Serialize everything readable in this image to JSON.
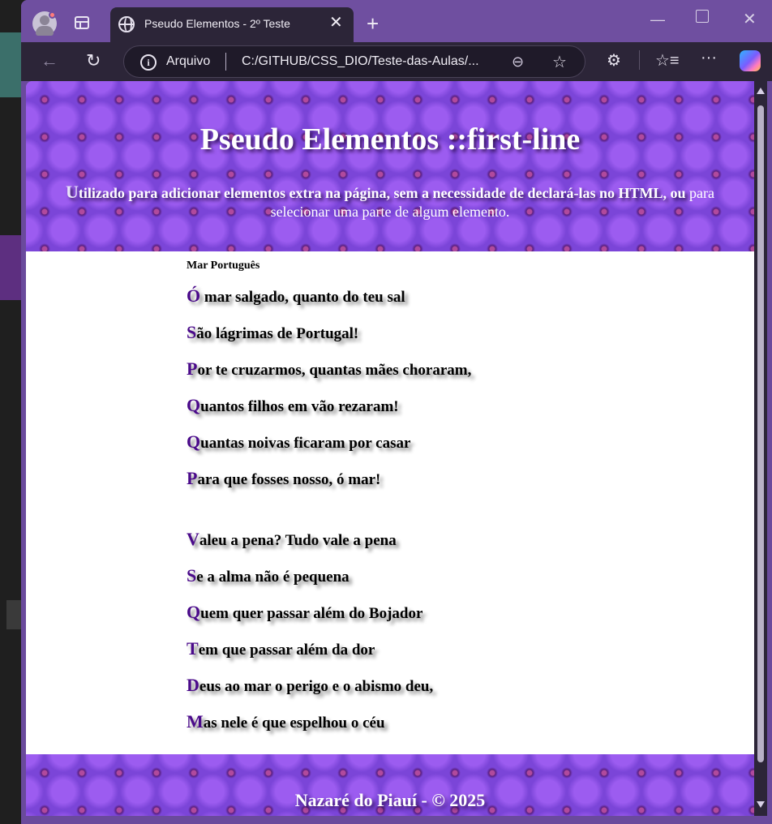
{
  "browser": {
    "tab_title": "Pseudo Elementos - 2º Teste",
    "new_tab_label": "+",
    "address_scheme": "Arquivo",
    "address_url": "C:/GITHUB/CSS_DIO/Teste-das-Aulas/...",
    "info_glyph": "i",
    "icons": [
      "profile-icon",
      "tabs-icon",
      "globe-icon",
      "close-icon",
      "minimize-icon",
      "maximize-icon",
      "back-icon",
      "refresh-icon",
      "info-icon",
      "zoom-icon",
      "favorite-star-icon",
      "extensions-icon",
      "favorites-icon",
      "more-icon",
      "copilot-icon"
    ]
  },
  "page": {
    "heading": "Pseudo Elementos ::first-line",
    "intro_first_letter": "U",
    "intro_first_line": "tilizado para adicionar elementos extra na página, sem a necessidade de declará-las no HTML, ou",
    "intro_rest": "para selecionar uma parte de algum elemento.",
    "poem_title": "Mar Português",
    "stanza1": [
      {
        "cap": "Ó",
        "rest": " mar salgado, quanto do teu sal"
      },
      {
        "cap": "S",
        "rest": "ão lágrimas de Portugal!"
      },
      {
        "cap": "P",
        "rest": "or te cruzarmos, quantas mães choraram,"
      },
      {
        "cap": "Q",
        "rest": "uantos filhos em vão rezaram!"
      },
      {
        "cap": "Q",
        "rest": "uantas noivas ficaram por casar"
      },
      {
        "cap": "P",
        "rest": "ara que fosses nosso, ó mar!"
      }
    ],
    "stanza2": [
      {
        "cap": "V",
        "rest": "aleu a pena? Tudo vale a pena"
      },
      {
        "cap": "S",
        "rest": "e a alma não é pequena"
      },
      {
        "cap": "Q",
        "rest": "uem quer passar além do Bojador"
      },
      {
        "cap": "T",
        "rest": "em que passar além da dor"
      },
      {
        "cap": "D",
        "rest": "eus ao mar o perigo e o abismo deu,"
      },
      {
        "cap": "M",
        "rest": "as nele é que espelhou o céu"
      }
    ],
    "footer": "Nazaré do Piauí - © 2025"
  },
  "colors": {
    "browser_frame": "#6f4fa0",
    "toolbar": "#2c2538",
    "banner_purple": "#7b45d8",
    "drop_cap": "#4a0a8a"
  }
}
